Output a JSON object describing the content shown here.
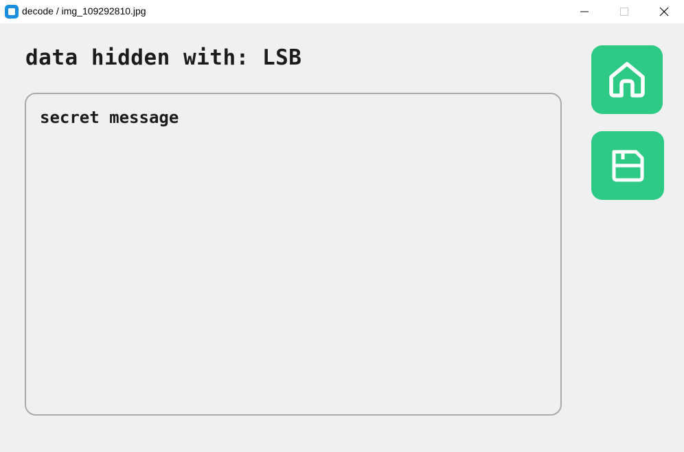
{
  "window": {
    "title": "decode / img_109292810.jpg",
    "controls": [
      "minimize-icon",
      "maximize-icon",
      "close-icon"
    ]
  },
  "main": {
    "heading": "data hidden with: LSB",
    "message_text": "secret message"
  },
  "actions": {
    "home_icon": "home-icon",
    "save_icon": "save-icon"
  },
  "colors": {
    "accent": "#2dca85",
    "background": "#f0f0f0",
    "text": "#1b1b1b",
    "border": "#a9a9a9"
  }
}
